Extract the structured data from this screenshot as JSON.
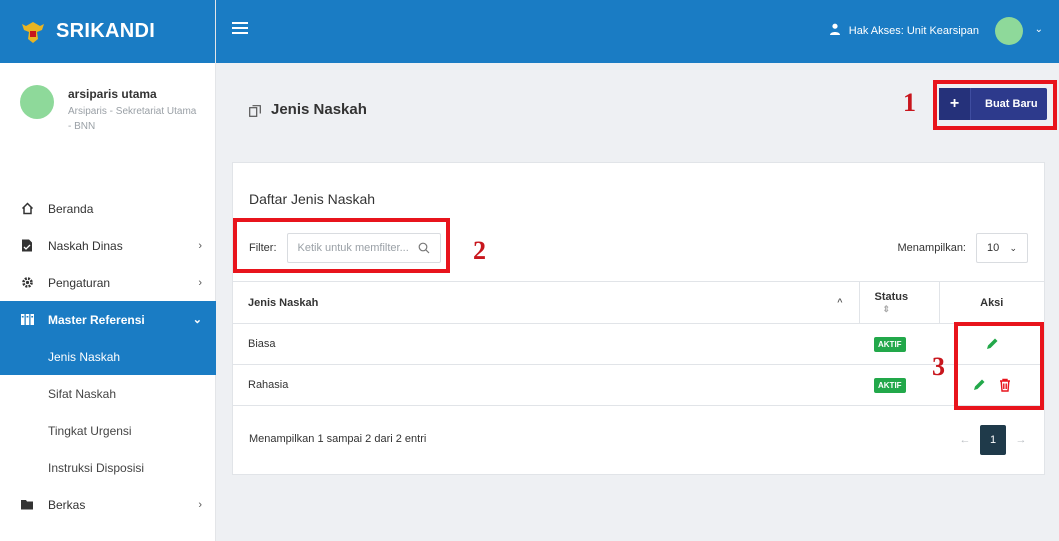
{
  "app": {
    "name": "SRIKANDI"
  },
  "user": {
    "name": "arsiparis utama",
    "role": "Arsiparis - Sekretariat Utama - BNN"
  },
  "header": {
    "access_label": "Hak Akses: Unit Kearsipan"
  },
  "sidebar": {
    "items": [
      {
        "label": "Beranda",
        "icon": "home-icon"
      },
      {
        "label": "Naskah Dinas",
        "icon": "document-icon"
      },
      {
        "label": "Pengaturan",
        "icon": "gear-icon"
      },
      {
        "label": "Master Referensi",
        "icon": "grid-icon"
      }
    ],
    "submenu": [
      {
        "label": "Jenis Naskah"
      },
      {
        "label": "Sifat Naskah"
      },
      {
        "label": "Tingkat Urgensi"
      },
      {
        "label": "Instruksi Disposisi"
      }
    ],
    "after": {
      "label": "Berkas",
      "icon": "folder-icon"
    }
  },
  "page": {
    "title": "Jenis Naskah",
    "create_label": "Buat Baru"
  },
  "card": {
    "title": "Daftar Jenis Naskah",
    "filter_label": "Filter:",
    "filter_placeholder": "Ketik untuk memfilter...",
    "show_label": "Menampilkan:",
    "show_value": "10",
    "columns": [
      "Jenis Naskah",
      "Status",
      "Aksi"
    ],
    "rows": [
      {
        "name": "Biasa",
        "status": "AKTIF"
      },
      {
        "name": "Rahasia",
        "status": "AKTIF"
      }
    ],
    "info": "Menampilkan 1 sampai 2 dari 2 entri",
    "page": "1"
  },
  "annotations": [
    "1",
    "2",
    "3"
  ],
  "colors": {
    "primary": "#1a7cc4",
    "button": "#2d3a8c",
    "active_badge": "#22a84a",
    "annotation": "#e8141c"
  }
}
